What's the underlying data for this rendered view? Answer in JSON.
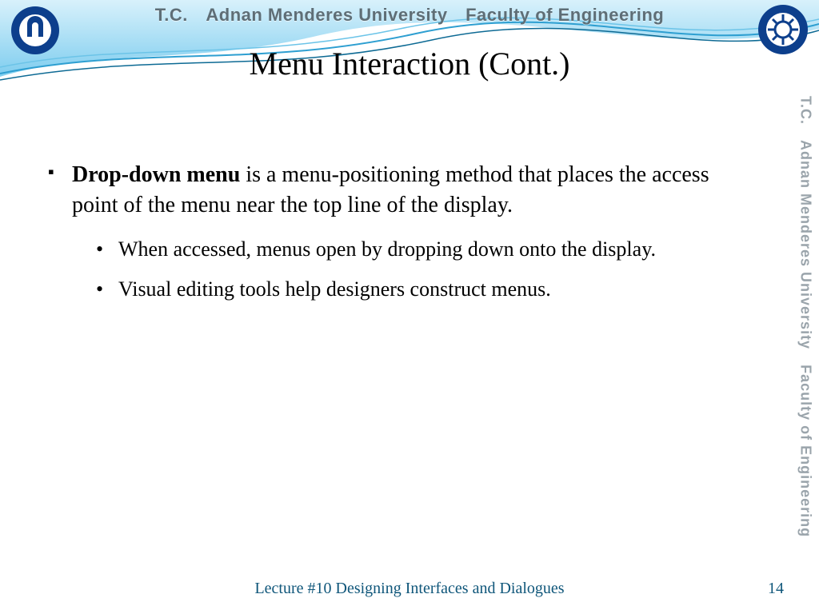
{
  "header": {
    "org_line": "T.C. Adnan Menderes University Faculty of Engineering"
  },
  "title": "Menu Interaction (Cont.)",
  "body": {
    "bullet_bold": "Drop-down menu",
    "bullet_rest": " is a menu-positioning method that places the access point of the menu near the top line of the display.",
    "sub1": "When accessed, menus open by dropping down onto the display.",
    "sub2": "Visual editing tools help designers construct menus."
  },
  "footer": {
    "lecture": "Lecture #10 Designing Interfaces and Dialogues",
    "page": "14"
  },
  "sidemark": "T.C. Adnan Menderes University Faculty of Engineering",
  "colors": {
    "footer_text": "#0f567a",
    "banner_light": "#bfe8f5",
    "banner_dark": "#3aa8d8"
  }
}
